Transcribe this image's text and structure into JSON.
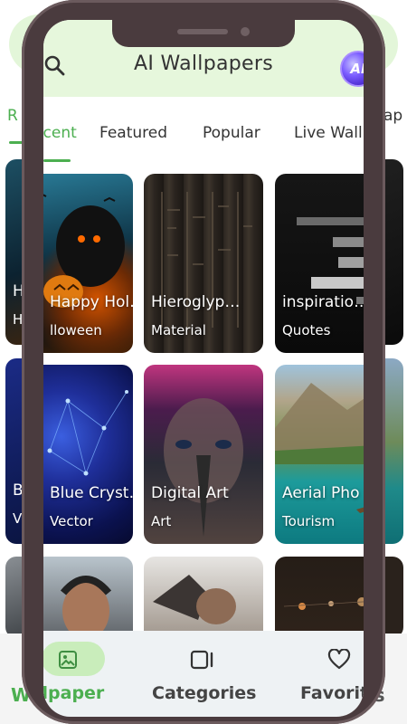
{
  "app": {
    "title": "AI Wallpapers",
    "avatar_text": "AI"
  },
  "tabs": [
    {
      "label": "Recent",
      "active": true
    },
    {
      "label": "Featured",
      "active": false
    },
    {
      "label": "Popular",
      "active": false
    },
    {
      "label": "Live Wallpapers",
      "active": false
    }
  ],
  "cards": [
    {
      "title": "Happy Holloween",
      "title_shown": "Happy Hol…",
      "category": "Halloween",
      "category_shown": "lloween"
    },
    {
      "title": "Hieroglyphics",
      "title_shown": "Hieroglyp…",
      "category": "Material"
    },
    {
      "title": "inspiration",
      "title_shown": "inspiratio…",
      "category": "Quotes"
    },
    {
      "title": "Blue Crystal",
      "title_shown": "Blue Cryst…",
      "category": "Vector"
    },
    {
      "title": "Digital Art",
      "title_shown": "Digital Art",
      "category": "Art"
    },
    {
      "title": "Aerial Photo",
      "title_shown": "Aerial Pho",
      "category": "Tourism"
    },
    {
      "title": "",
      "category": ""
    },
    {
      "title": "",
      "category": ""
    },
    {
      "title": "",
      "category": ""
    }
  ],
  "nav": [
    {
      "label": "Wallpaper",
      "label_shown": "llpaper",
      "icon": "image-icon",
      "active": true
    },
    {
      "label": "Categories",
      "icon": "categories-icon",
      "active": false
    },
    {
      "label": "Favorites",
      "label_shown": "Favorit",
      "icon": "heart-icon",
      "active": false
    }
  ],
  "background": {
    "tab_left": "R",
    "tab_right": "ap",
    "nav_left": "W",
    "nav_right": "es",
    "card_captions": [
      "H",
      "H",
      "B",
      "V"
    ]
  },
  "colors": {
    "accent": "#4caf50",
    "header_bg": "#e6f7dc",
    "frame": "#4a3b3e"
  }
}
